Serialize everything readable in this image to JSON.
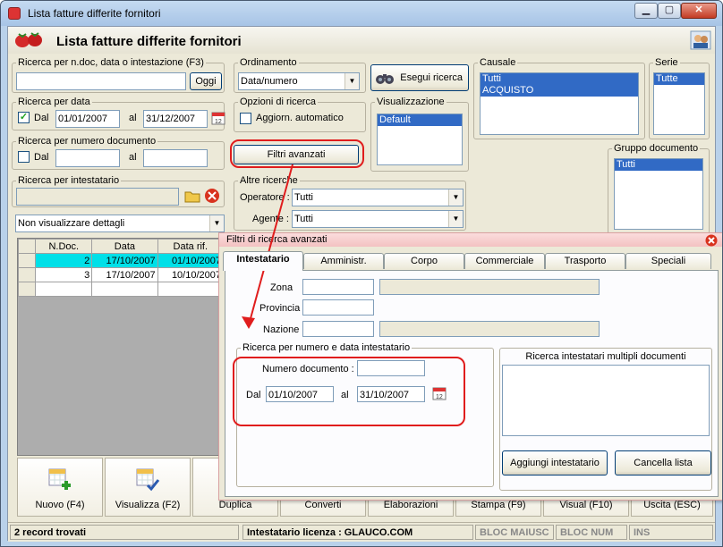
{
  "window": {
    "title": "Lista fatture differite fornitori",
    "min": "▁",
    "max": "▢",
    "close": "✕"
  },
  "header": {
    "title": "Lista fatture differite fornitori"
  },
  "search_text": {
    "legend": "Ricerca per n.doc, data o intestazione (F3)",
    "value": "",
    "button": "Oggi"
  },
  "ordinamento": {
    "legend": "Ordinamento",
    "value": "Data/numero"
  },
  "esegui": {
    "label": "Esegui ricerca"
  },
  "causale": {
    "legend": "Causale",
    "items": [
      "Tutti",
      "ACQUISTO"
    ]
  },
  "serie": {
    "legend": "Serie",
    "items": [
      "Tutte"
    ]
  },
  "ricerca_data": {
    "legend": "Ricerca per data",
    "dal_label": "Dal",
    "dal": "01/01/2007",
    "al_label": "al",
    "al": "31/12/2007",
    "checked": "✓"
  },
  "opzioni": {
    "legend": "Opzioni di ricerca",
    "auto_label": "Aggiorn. automatico"
  },
  "visualizzazione": {
    "legend": "Visualizzazione",
    "items": [
      "Default"
    ]
  },
  "ricerca_numero": {
    "legend": "Ricerca per numero documento",
    "dal_label": "Dal",
    "al_label": "al",
    "dal": "",
    "al": ""
  },
  "filtri_btn": {
    "label": "Filtri avanzati"
  },
  "gruppo": {
    "legend": "Gruppo documento",
    "items": [
      "Tutti"
    ]
  },
  "intestatario": {
    "legend": "Ricerca per intestatario",
    "value": ""
  },
  "altre": {
    "legend": "Altre ricerche",
    "operatore_label": "Operatore :",
    "operatore": "Tutti",
    "agente_label": "Agente :",
    "agente": "Tutti"
  },
  "dettagli": {
    "value": "Non visualizzare dettagli"
  },
  "grid": {
    "columns": [
      "N.Doc.",
      "Data",
      "Data rif."
    ],
    "rows": [
      [
        "2",
        "17/10/2007",
        "01/10/2007"
      ],
      [
        "3",
        "17/10/2007",
        "10/10/2007"
      ]
    ]
  },
  "dialog": {
    "title": "Filtri di ricerca avanzati",
    "tabs": [
      "Intestatario",
      "Amministr.",
      "Corpo",
      "Commerciale",
      "Trasporto",
      "Speciali"
    ],
    "zona_label": "Zona",
    "provincia_label": "Provincia",
    "nazione_label": "Nazione",
    "ricnum_legend": "Ricerca per numero e data intestatario",
    "numdoc_label": "Numero documento :",
    "numdoc": "",
    "dal_label": "Dal",
    "dal": "01/10/2007",
    "al_label": "al",
    "al": "31/10/2007",
    "multi_header": "Ricerca intestatari multipli documenti",
    "add_btn": "Aggiungi intestatario",
    "cancel_btn": "Cancella lista"
  },
  "toolbar": [
    "Nuovo (F4)",
    "Visualizza (F2)",
    "Duplica",
    "Converti",
    "Elaborazioni",
    "Stampa (F9)",
    "Visual (F10)",
    "Uscita (ESC)"
  ],
  "status": {
    "records": "2 record trovati",
    "license": "Intestatario licenza : GLAUCO.COM",
    "caps": "BLOC MAIUSC",
    "num": "BLOC NUM",
    "ins": "INS"
  },
  "colors": {
    "highlight": "#e01d1d",
    "selection": "#316ac5",
    "cyan_row": "#00e0e8"
  }
}
